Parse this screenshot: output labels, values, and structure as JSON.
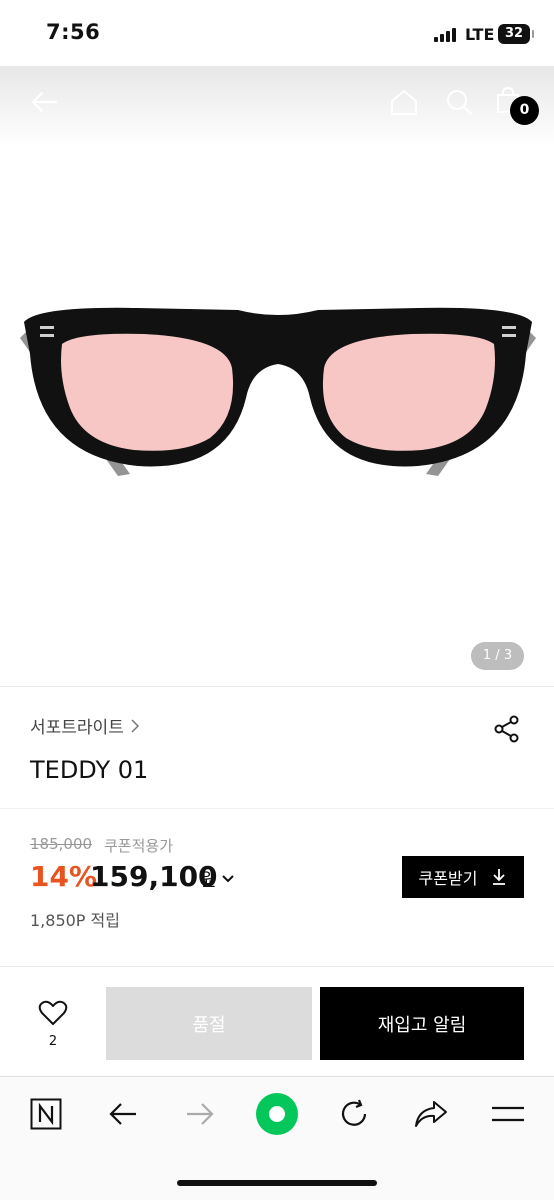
{
  "status_bar": {
    "time": "7:56",
    "network": "LTE",
    "battery": "32"
  },
  "top_nav": {
    "cart_count": "0"
  },
  "gallery": {
    "counter": "1 / 3"
  },
  "product": {
    "brand": "서포트라이트",
    "name": "TEDDY 01",
    "original_price": "185,000",
    "coupon_note": "쿠폰적용가",
    "discount": "14%",
    "price": "159,100",
    "currency": "원",
    "coupon_button": "쿠폰받기",
    "points": "1,850P 적립"
  },
  "actions": {
    "wish_count": "2",
    "soldout_label": "품절",
    "notify_label": "재입고 알림"
  },
  "colors": {
    "discount": "#e8531f",
    "lens": "#f6c7c5",
    "frame": "#111111",
    "naver_green": "#03c75a"
  },
  "browser_bar": {
    "icons": [
      "naver-n-icon",
      "back-arrow-icon",
      "forward-arrow-icon",
      "green-dot-icon",
      "refresh-icon",
      "share-icon",
      "menu-icon"
    ]
  }
}
